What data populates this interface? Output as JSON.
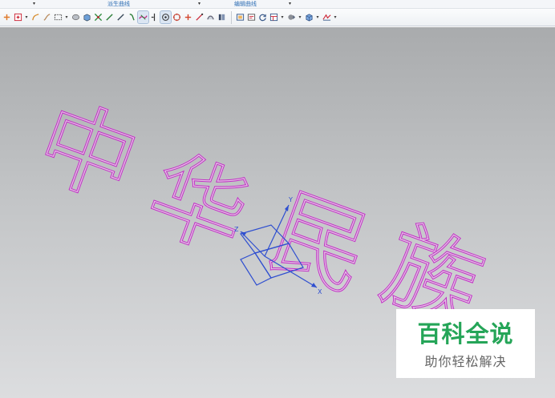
{
  "ribbon": {
    "groups": [
      {
        "label": ""
      },
      {
        "label": "派生曲线"
      },
      {
        "label": "编辑曲线"
      }
    ],
    "dropdown_glyph": "▾"
  },
  "toolbar": {
    "icons": [
      "point-icon",
      "point-set-icon",
      "curve-icon",
      "sketch-icon",
      "rectangle-icon",
      "extrude-icon",
      "block-icon",
      "snap-points-icon",
      "line-icon",
      "line-alt-icon",
      "arc-icon",
      "spline-icon",
      "intersection-icon",
      "center-point-icon",
      "target-circle-icon",
      "plus-icon",
      "slash-icon",
      "helix-icon",
      "text-icon",
      "view-frame-icon",
      "section-view-icon",
      "refresh-icon",
      "layout-icon",
      "shaded-icon",
      "cube-icon",
      "measure-icon"
    ],
    "pressed_icons": [
      "intersection-icon",
      "center-point-icon"
    ]
  },
  "viewport": {
    "model_text": [
      "中",
      "华",
      "民",
      "族"
    ],
    "model_color": "#c22ec6",
    "axis_color": "#2f4fd0",
    "axes": {
      "x": "X",
      "y": "Y",
      "z": "Z"
    }
  },
  "watermark": {
    "title": "百科全说",
    "subtitle": "助你轻松解决",
    "title_color": "#25a558"
  }
}
